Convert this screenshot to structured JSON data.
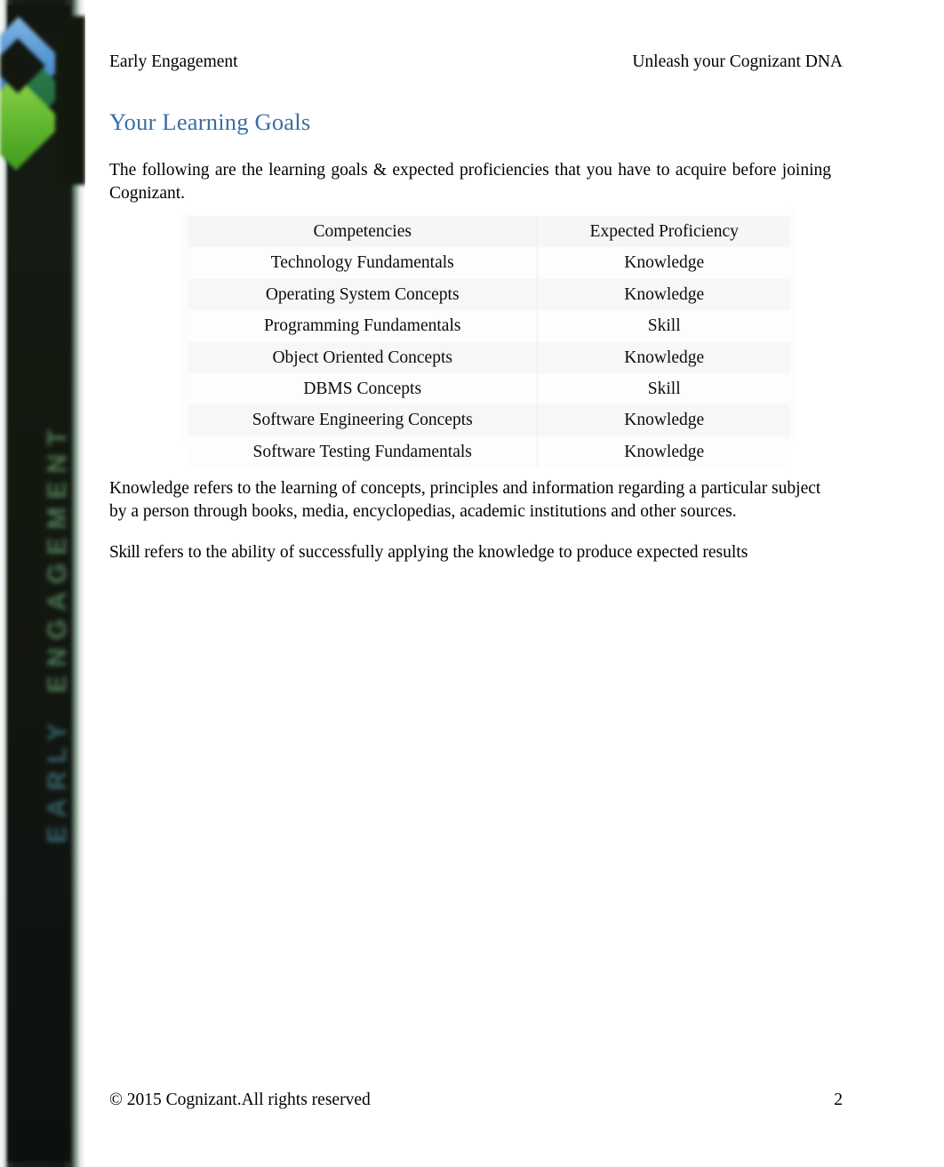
{
  "document": {
    "header": {
      "left": "Early Engagement",
      "right": "Unleash your Cognizant DNA"
    },
    "title": "Your Learning Goals",
    "title_color": "#3a6ea5",
    "intro_paragraph": "The following are the learning goals & expected proficiencies that you have to acquire before joining Cognizant.",
    "definitions": {
      "knowledge": "Knowledge refers to the learning of concepts, principles and information regarding a particular subject by a person through books, media, encyclopedias, academic institutions and other sources.",
      "skill_term": "Skill",
      "skill_rest": "refers to the ability of successfully applying the knowledge to produce expected results"
    },
    "footer": {
      "copyright": "© 2015 Cognizant.All rights reserved",
      "page_number": "2"
    }
  },
  "competency_table": {
    "columns": [
      "Competencies",
      "Expected Proficiency"
    ],
    "rows": [
      {
        "competency": "Technology Fundamentals",
        "proficiency": "Knowledge"
      },
      {
        "competency": "Operating System Concepts",
        "proficiency": "Knowledge"
      },
      {
        "competency": "Programming Fundamentals",
        "proficiency": "Skill"
      },
      {
        "competency": "Object Oriented Concepts",
        "proficiency": "Knowledge"
      },
      {
        "competency": "DBMS Concepts",
        "proficiency": "Skill"
      },
      {
        "competency": "Software Engineering Concepts",
        "proficiency": "Knowledge"
      },
      {
        "competency": "Software Testing Fundamentals",
        "proficiency": "Knowledge"
      }
    ]
  },
  "sidebar": {
    "vertical_text_top": "EARLY",
    "vertical_text_bottom": "ENGAGEMENT",
    "colors": {
      "background": "#13180f",
      "chevron_blue": "#4e91cf",
      "chevron_green": "#63b830",
      "chevron_green_dark": "#2c7a4a"
    }
  }
}
